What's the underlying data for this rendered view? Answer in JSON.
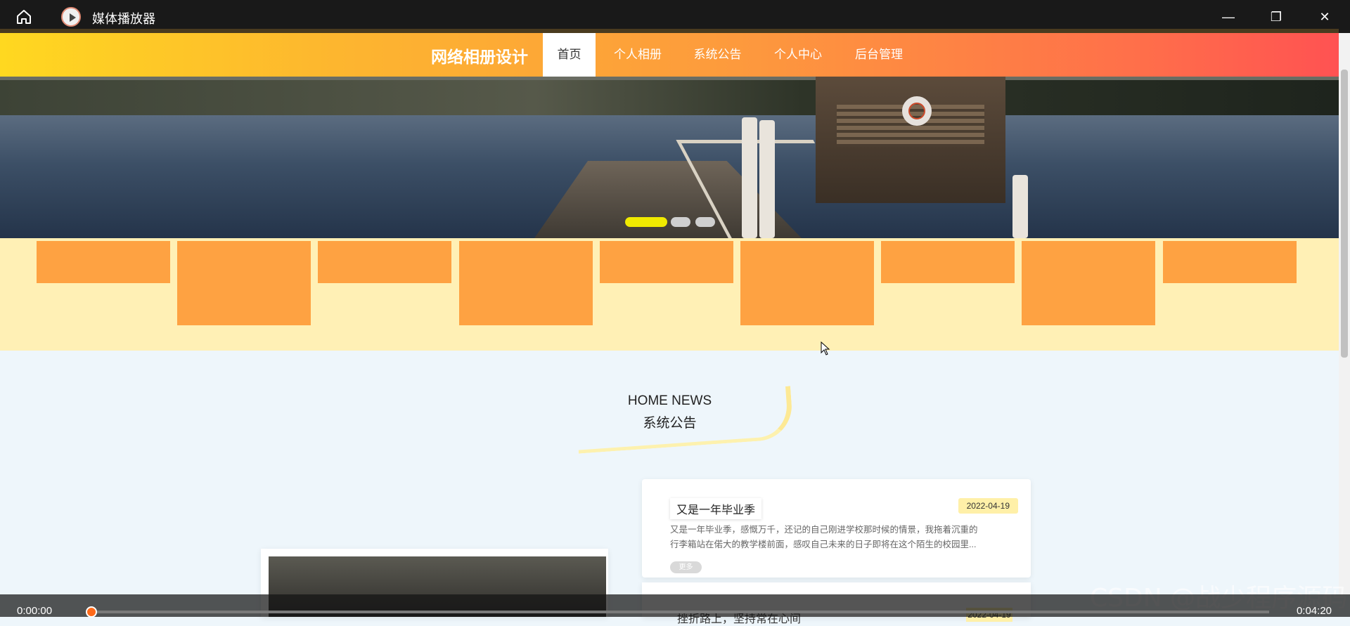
{
  "window": {
    "app_title": "媒体播放器",
    "icons": [
      "home-icon",
      "media-player-icon",
      "minimize-icon",
      "restore-icon",
      "close-icon"
    ]
  },
  "nav": {
    "brand": "网络相册设计",
    "items": [
      {
        "label": "首页",
        "active": true
      },
      {
        "label": "个人相册",
        "active": false
      },
      {
        "label": "系统公告",
        "active": false
      },
      {
        "label": "个人中心",
        "active": false
      },
      {
        "label": "后台管理",
        "active": false
      }
    ]
  },
  "carousel": {
    "slide_count": 3,
    "active_index": 0,
    "dot_active_color": "#f0ea00",
    "dot_color": "#cfcfcf"
  },
  "section": {
    "title_en": "HOME NEWS",
    "title_cn": "系统公告"
  },
  "news": [
    {
      "title": "又是一年毕业季",
      "date": "2022-04-19",
      "excerpt_line1": "又是一年毕业季，感慨万千，还记的自己刚进学校那时候的情景，我拖着沉重的",
      "excerpt_line2": "行李箱站在偌大的教学楼前面，感叹自己未来的日子即将在这个陌生的校园里...",
      "tag": "更多"
    },
    {
      "title": "挫折路上，坚持常在心间",
      "date": "2022-04-19"
    }
  ],
  "player": {
    "current_time": "0:00:00",
    "total_time": "0:04:20",
    "progress": 0
  },
  "watermark": "CSDN @战少程序源码",
  "colors": {
    "accent_orange": "#fea242",
    "band_bg": "#fff0b5",
    "page_bg": "#eef6fb"
  }
}
